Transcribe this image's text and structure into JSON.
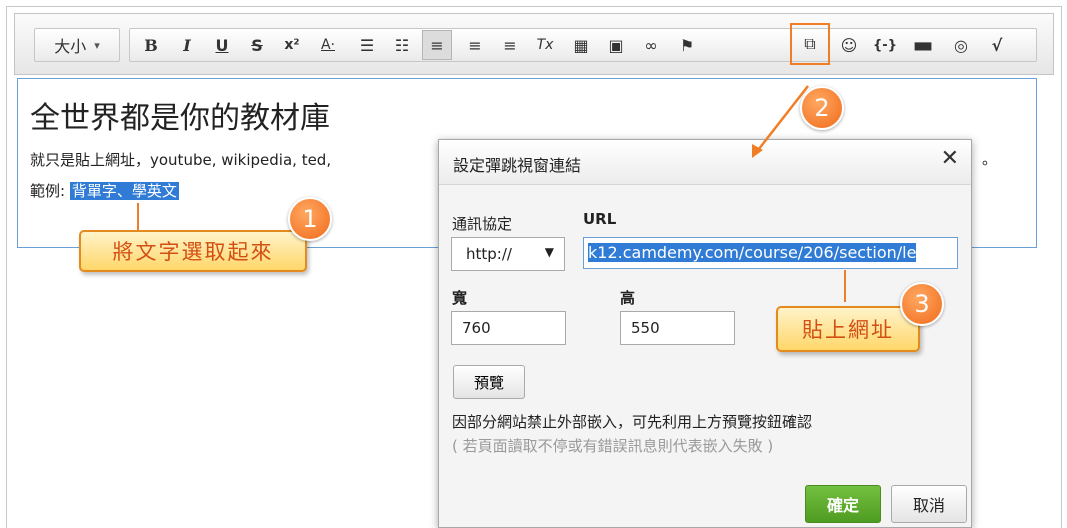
{
  "toolbar": {
    "size_label": "大小",
    "size_caret": "▾",
    "buttons": [
      {
        "icon": "bold-icon",
        "glyph": "B"
      },
      {
        "icon": "italic-icon",
        "glyph": "I"
      },
      {
        "icon": "underline-icon",
        "glyph": "U"
      },
      {
        "icon": "strikethrough-icon",
        "glyph": "S"
      },
      {
        "icon": "superscript-icon",
        "glyph": "x²"
      },
      {
        "icon": "font-color-icon",
        "glyph": "A·"
      },
      {
        "icon": "ordered-list-icon",
        "glyph": "☰"
      },
      {
        "icon": "unordered-list-icon",
        "glyph": "☷"
      },
      {
        "icon": "align-left-icon",
        "glyph": "≡"
      },
      {
        "icon": "align-center-icon",
        "glyph": "≡"
      },
      {
        "icon": "align-right-icon",
        "glyph": "≡"
      },
      {
        "icon": "clear-format-icon",
        "glyph": "Tx"
      },
      {
        "icon": "table-icon",
        "glyph": "▦"
      },
      {
        "icon": "image-icon",
        "glyph": "▣"
      },
      {
        "icon": "link-icon",
        "glyph": "∞"
      },
      {
        "icon": "flag-icon",
        "glyph": "⚑"
      },
      {
        "icon": "popup-link-icon",
        "glyph": "⧉"
      },
      {
        "icon": "emoji-icon",
        "glyph": "☺"
      },
      {
        "icon": "code-icon",
        "glyph": "{-}"
      },
      {
        "icon": "folder-icon",
        "glyph": "▬"
      },
      {
        "icon": "globe-icon",
        "glyph": "◎"
      },
      {
        "icon": "math-icon",
        "glyph": "√"
      }
    ]
  },
  "editor": {
    "title": "全世界都是你的教材庫",
    "line1": "就只是貼上網址，youtube, wikipedia, ted,",
    "line1_end": "。",
    "line2_prefix": "範例: ",
    "line2_selected": "背單字、學英文"
  },
  "dialog": {
    "title": "設定彈跳視窗連結",
    "close": "✕",
    "protocol_label": "通訊協定",
    "protocol_value": "http://",
    "protocol_arrow": "▼",
    "url_label": "URL",
    "url_value": "k12.camdemy.com/course/206/section/le",
    "width_label": "寬",
    "width_value": "760",
    "height_label": "高",
    "height_value": "550",
    "preview_button": "預覽",
    "note": "因部分網站禁止外部嵌入，可先利用上方預覽按鈕確認",
    "note_sub": "( 若頁面讀取不停或有錯誤訊息則代表嵌入失敗 )",
    "ok_button": "確定",
    "cancel_button": "取消"
  },
  "annotations": {
    "step1": {
      "number": "1",
      "text": "將文字選取起來"
    },
    "step2": {
      "number": "2"
    },
    "step3": {
      "number": "3",
      "text": "貼上網址"
    }
  },
  "colors": {
    "accent_orange": "#f07e26",
    "selection_blue": "#2f7bd6",
    "ok_green": "#5aa92c"
  }
}
